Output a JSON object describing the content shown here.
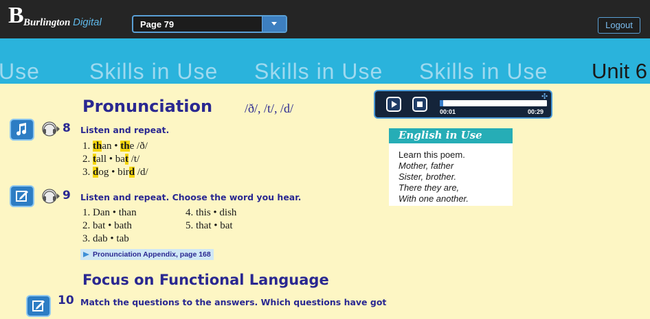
{
  "topbar": {
    "logo_letter": "B",
    "logo_brand": "Burlington",
    "logo_product": "Digital",
    "page_select_value": "Page 79",
    "logout_label": "Logout"
  },
  "banner": {
    "texts": [
      "Use",
      "Skills in Use",
      "Skills in Use",
      "Skills in Use"
    ],
    "unit": "Unit 6"
  },
  "pronunciation": {
    "title": "Pronunciation",
    "phonemes": "/ð/, /t/, /d/"
  },
  "exercise8": {
    "number": "8",
    "instruction": "Listen and repeat.",
    "items": [
      {
        "n": "1.",
        "w1a": "",
        "w1h": "th",
        "w1b": "an",
        "w2a": "",
        "w2h": "th",
        "w2b": "e",
        "ipa": "/ð/"
      },
      {
        "n": "2.",
        "w1a": "",
        "w1h": "t",
        "w1b": "all",
        "w2a": "ba",
        "w2h": "t",
        "w2b": "",
        "ipa": "/t/"
      },
      {
        "n": "3.",
        "w1a": "",
        "w1h": "d",
        "w1b": "og",
        "w2a": "bir",
        "w2h": "d",
        "w2b": "",
        "ipa": "/d/"
      }
    ]
  },
  "exercise9": {
    "number": "9",
    "instruction": "Listen and repeat. Choose the word you hear.",
    "left": [
      "1. Dan • than",
      "2. bat • bath",
      "3. dab • tab"
    ],
    "right": [
      "4. this • dish",
      "5. that • bat"
    ],
    "appendix": "Pronunciation Appendix, page 168"
  },
  "functional": {
    "title": "Focus on Functional Language"
  },
  "exercise10": {
    "number": "10",
    "instruction": "Match the questions to the answers. Which questions have got"
  },
  "player": {
    "current": "00:01",
    "total": "00:29",
    "progress": 0.03
  },
  "english_in_use": {
    "title": "English in Use",
    "lines": [
      "Learn this poem.",
      "Mother, father",
      "Sister, brother.",
      "There they are,",
      "With one another."
    ]
  },
  "colors": {
    "banner": "#2ab3dc",
    "page_bg": "#fdf6c4",
    "heading": "#2a2891",
    "highlight": "#f5d60c",
    "topbar": "#252525"
  },
  "icons": {
    "play": "play-icon",
    "stop": "stop-icon",
    "music": "music-note-icon",
    "edit": "edit-icon",
    "audio": "audio-cd-icon",
    "move": "move-icon"
  }
}
